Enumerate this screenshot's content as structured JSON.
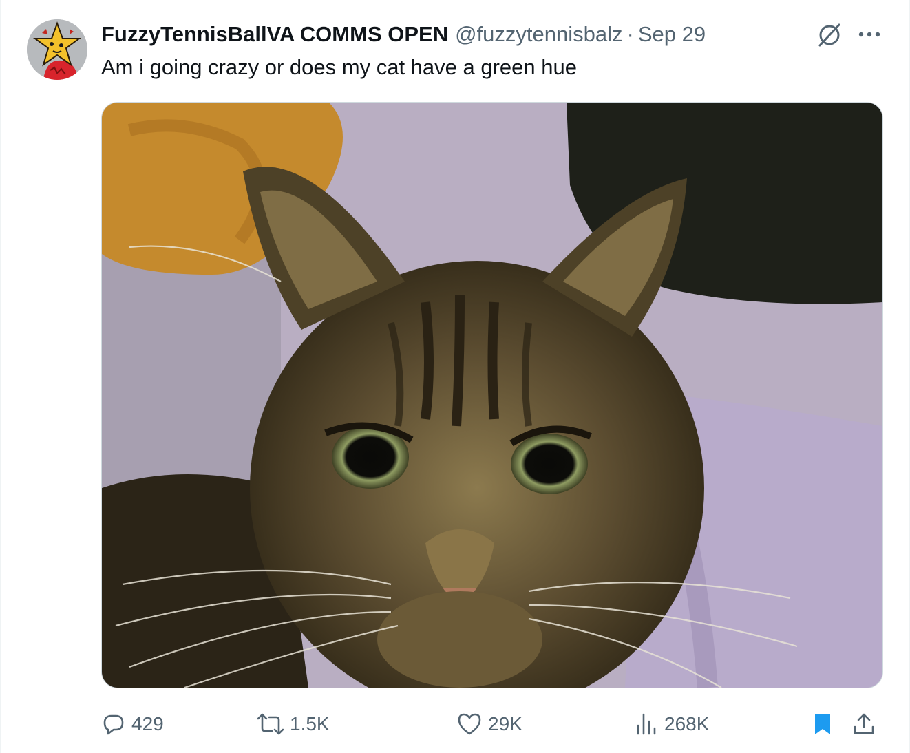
{
  "tweet": {
    "display_name": "FuzzyTennisBallVA COMMS OPEN",
    "handle": "@fuzzytennisbalz",
    "separator": "·",
    "date": "Sep 29",
    "text": "Am i going crazy or does my cat have a green hue",
    "media_alt": "Photo of a tabby cat"
  },
  "actions": {
    "replies": "429",
    "reposts": "1.5K",
    "likes": "29K",
    "views": "268K"
  },
  "icons": {
    "header_right": [
      "grok-icon",
      "more-icon"
    ],
    "action_bar": [
      "reply-icon",
      "repost-icon",
      "like-icon",
      "views-icon",
      "bookmark-icon",
      "share-icon"
    ]
  },
  "colors": {
    "text_primary": "#0f1419",
    "text_secondary": "#536471",
    "bookmark_active": "#1d9bf0",
    "border": "#cfd9de"
  }
}
